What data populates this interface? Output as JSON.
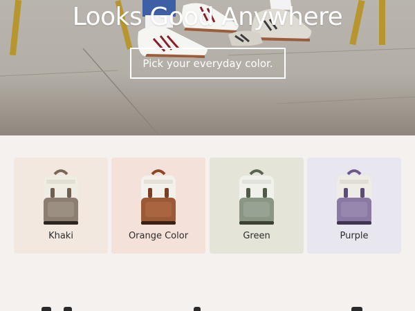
{
  "hero": {
    "title": "Looks Good Anywhere",
    "cta_label": "Pick your everyday color."
  },
  "colors": {
    "items": [
      {
        "label": "Khaki",
        "card_bg": "#f2e8df",
        "bottom": "#8c7f72",
        "trim": "#6e5f50",
        "handle": "#7a6654"
      },
      {
        "label": "Orange Color",
        "card_bg": "#f3e1da",
        "bottom": "#9a5a36",
        "trim": "#7a3f22",
        "handle": "#8a4826"
      },
      {
        "label": "Green",
        "card_bg": "#e4e4d8",
        "bottom": "#8a9584",
        "trim": "#4f5a48",
        "handle": "#5a6452"
      },
      {
        "label": "Purple",
        "card_bg": "#e8e6ee",
        "bottom": "#8a7aa3",
        "trim": "#5b4d75",
        "handle": "#6d5a8c"
      }
    ]
  }
}
